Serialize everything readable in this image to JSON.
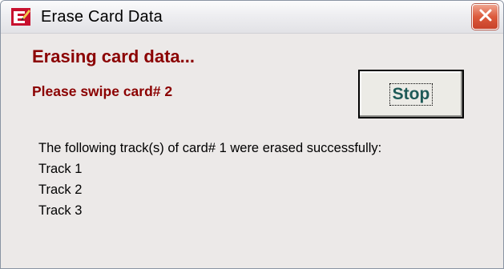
{
  "window": {
    "title": "Erase Card Data",
    "app_icon": "red-pen-icon",
    "close_icon": "close-x-icon"
  },
  "main": {
    "heading": "Erasing card data...",
    "subheading": "Please swipe card# 2",
    "stop_button": "Stop",
    "result_message": "The following track(s) of card# 1 were erased successfully:",
    "tracks": [
      "Track 1",
      "Track 2",
      "Track 3"
    ]
  },
  "colors": {
    "heading": "#8b0000",
    "stop_label": "#1e5a57",
    "dialog_background": "#ece9e8",
    "close_button": "#dc5a3c"
  }
}
